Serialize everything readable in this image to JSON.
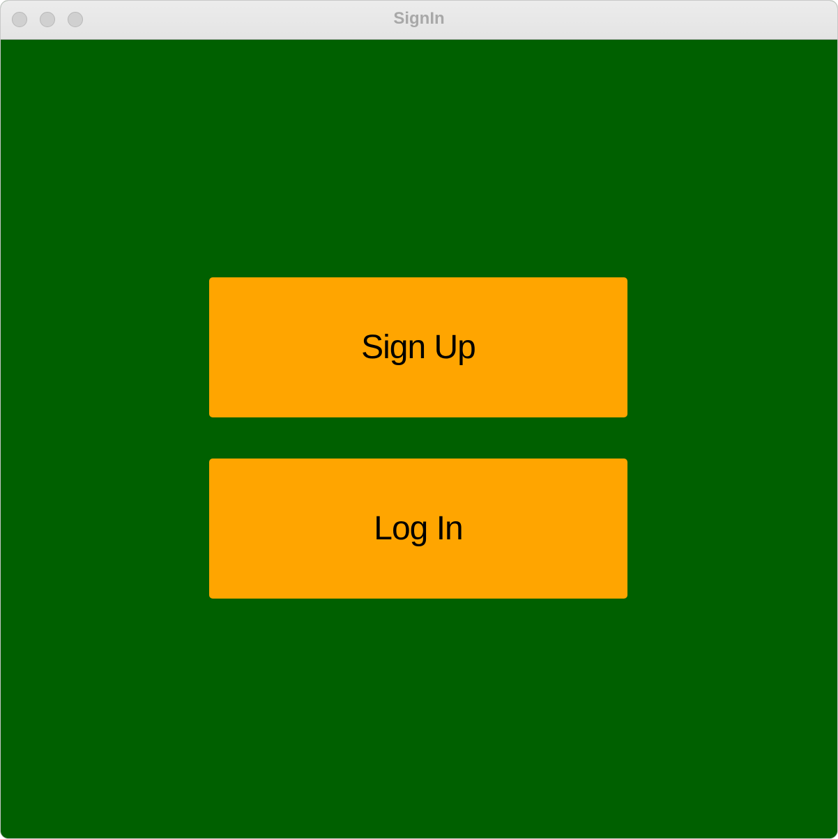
{
  "window": {
    "title": "SignIn"
  },
  "main": {
    "signup_label": "Sign Up",
    "login_label": "Log In"
  },
  "colors": {
    "background": "#006000",
    "button": "#ffa500",
    "button_text": "#000000",
    "title_text": "#a8a8a8"
  }
}
